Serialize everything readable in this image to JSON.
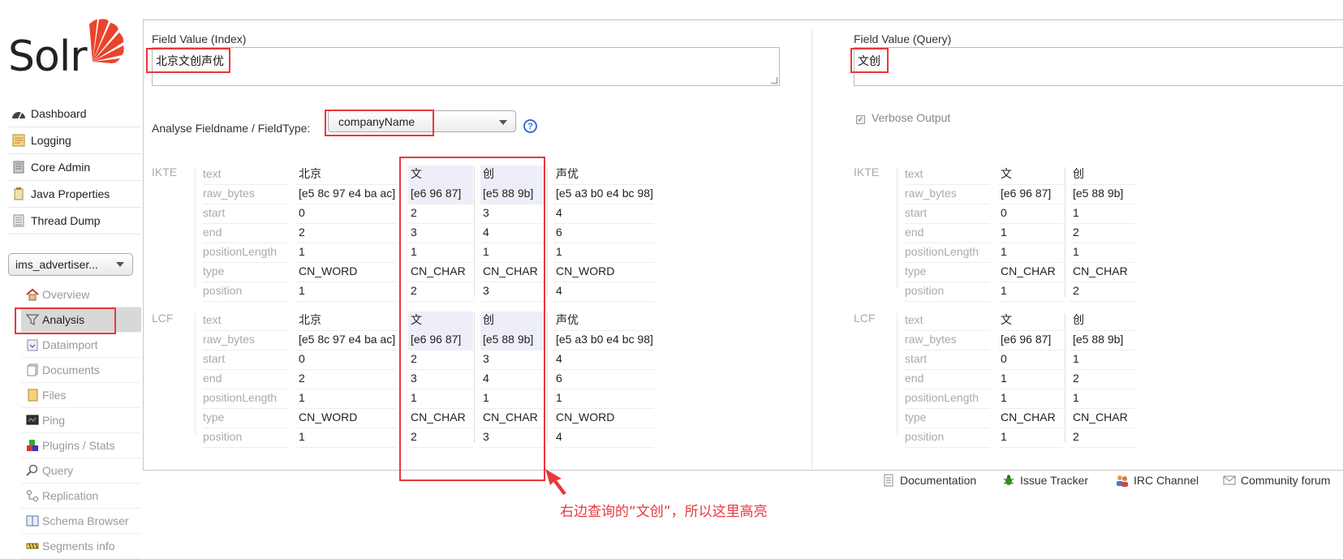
{
  "logo": {
    "text": "Solr"
  },
  "nav": [
    {
      "name": "dashboard",
      "label": "Dashboard"
    },
    {
      "name": "logging",
      "label": "Logging"
    },
    {
      "name": "core-admin",
      "label": "Core Admin"
    },
    {
      "name": "java-properties",
      "label": "Java Properties"
    },
    {
      "name": "thread-dump",
      "label": "Thread Dump"
    }
  ],
  "core_selector": {
    "value": "ims_advertiser..."
  },
  "core_menu": [
    {
      "label": "Overview"
    },
    {
      "label": "Analysis"
    },
    {
      "label": "Dataimport"
    },
    {
      "label": "Documents"
    },
    {
      "label": "Files"
    },
    {
      "label": "Ping"
    },
    {
      "label": "Plugins / Stats"
    },
    {
      "label": "Query"
    },
    {
      "label": "Replication"
    },
    {
      "label": "Schema Browser"
    },
    {
      "label": "Segments info"
    }
  ],
  "analysis": {
    "index_label": "Field Value (Index)",
    "index_value": "北京文创声优",
    "query_label": "Field Value (Query)",
    "query_value": "文创",
    "fieldtype_label": "Analyse Fieldname / FieldType:",
    "fieldtype_value": "companyName",
    "help": "?",
    "verbose_label": "Verbose Output",
    "verbose_check": "✓"
  },
  "attr_names": [
    "text",
    "raw_bytes",
    "start",
    "end",
    "positionLength",
    "type",
    "position"
  ],
  "index_groups": [
    {
      "name": "IKTE",
      "tokens": [
        [
          "北京",
          "[e5 8c 97 e4 ba ac]",
          "0",
          "2",
          "1",
          "CN_WORD",
          "1"
        ],
        [
          "文",
          "[e6 96 87]",
          "2",
          "3",
          "1",
          "CN_CHAR",
          "2"
        ],
        [
          "创",
          "[e5 88 9b]",
          "3",
          "4",
          "1",
          "CN_CHAR",
          "3"
        ],
        [
          "声优",
          "[e5 a3 b0 e4 bc 98]",
          "4",
          "6",
          "1",
          "CN_WORD",
          "4"
        ]
      ]
    },
    {
      "name": "LCF",
      "tokens": [
        [
          "北京",
          "[e5 8c 97 e4 ba ac]",
          "0",
          "2",
          "1",
          "CN_WORD",
          "1"
        ],
        [
          "文",
          "[e6 96 87]",
          "2",
          "3",
          "1",
          "CN_CHAR",
          "2"
        ],
        [
          "创",
          "[e5 88 9b]",
          "3",
          "4",
          "1",
          "CN_CHAR",
          "3"
        ],
        [
          "声优",
          "[e5 a3 b0 e4 bc 98]",
          "4",
          "6",
          "1",
          "CN_WORD",
          "4"
        ]
      ]
    }
  ],
  "query_groups": [
    {
      "name": "IKTE",
      "tokens": [
        [
          "文",
          "[e6 96 87]",
          "0",
          "1",
          "1",
          "CN_CHAR",
          "1"
        ],
        [
          "创",
          "[e5 88 9b]",
          "1",
          "2",
          "1",
          "CN_CHAR",
          "2"
        ]
      ]
    },
    {
      "name": "LCF",
      "tokens": [
        [
          "文",
          "[e6 96 87]",
          "0",
          "1",
          "1",
          "CN_CHAR",
          "1"
        ],
        [
          "创",
          "[e5 88 9b]",
          "1",
          "2",
          "1",
          "CN_CHAR",
          "2"
        ]
      ]
    }
  ],
  "annotation": "右边查询的“文创”，所以这里高亮",
  "footer": [
    {
      "name": "documentation",
      "label": "Documentation"
    },
    {
      "name": "issue-tracker",
      "label": "Issue Tracker"
    },
    {
      "name": "irc-channel",
      "label": "IRC Channel"
    },
    {
      "name": "community-forum",
      "label": "Community forum"
    }
  ],
  "colors": {
    "highlight_box": "#e8383d",
    "logo_accent": "#e8452c",
    "token_highlight": "#eeeefa"
  }
}
